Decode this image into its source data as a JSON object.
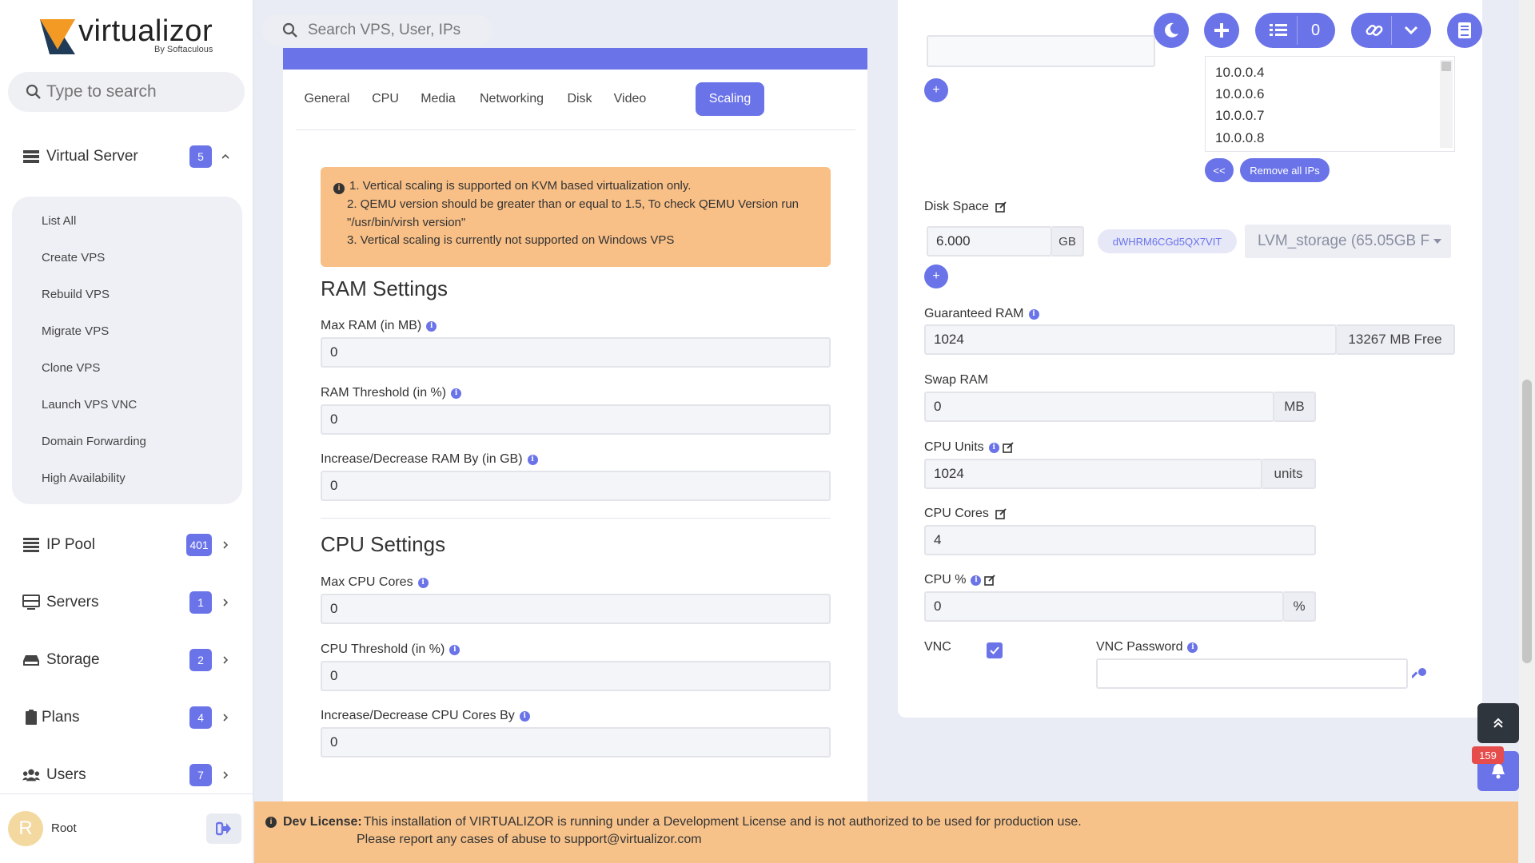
{
  "brand": {
    "name": "virtualizor",
    "by": "By Softaculous"
  },
  "sidebar": {
    "search_placeholder": "Type to search",
    "items": [
      {
        "label": "Virtual Server",
        "badge": "5"
      },
      {
        "label": "IP Pool",
        "badge": "401"
      },
      {
        "label": "Servers",
        "badge": "1"
      },
      {
        "label": "Storage",
        "badge": "2"
      },
      {
        "label": "Plans",
        "badge": "4"
      },
      {
        "label": "Users",
        "badge": "7"
      }
    ],
    "submenu": [
      "List All",
      "Create VPS",
      "Rebuild VPS",
      "Migrate VPS",
      "Clone VPS",
      "Launch VPS VNC",
      "Domain Forwarding",
      "High Availability"
    ],
    "user": {
      "initial": "R",
      "name": "Root"
    }
  },
  "topbar": {
    "search_placeholder": "Search VPS, User, IPs",
    "task_count": "0"
  },
  "tabs": [
    "General",
    "CPU",
    "Media",
    "Networking",
    "Disk",
    "Video",
    "Scaling"
  ],
  "alert": {
    "line1": "1. Vertical scaling is supported on KVM based virtualization only.",
    "line2": "2. QEMU version should be greater than or equal to 1.5, To check QEMU Version run \"/usr/bin/virsh version\"",
    "line3": "3. Vertical scaling is currently not supported on Windows VPS"
  },
  "ram_settings": {
    "title": "RAM Settings",
    "max_ram_label": "Max RAM (in MB)",
    "max_ram": "0",
    "threshold_label": "RAM Threshold (in %)",
    "threshold": "0",
    "increase_label": "Increase/Decrease RAM By (in GB)",
    "increase": "0"
  },
  "cpu_settings": {
    "title": "CPU Settings",
    "max_cores_label": "Max CPU Cores",
    "max_cores": "0",
    "threshold_label": "CPU Threshold (in %)",
    "threshold": "0",
    "increase_label": "Increase/Decrease CPU Cores By",
    "increase": "0"
  },
  "right": {
    "ips": [
      "10.0.0.4",
      "10.0.0.6",
      "10.0.0.7",
      "10.0.0.8"
    ],
    "ip_back": "<<",
    "remove_ips": "Remove all IPs",
    "disk_label": "Disk Space",
    "disk_value": "6.000",
    "disk_unit": "GB",
    "disk_id": "dWHRM6CGd5QX7VIT",
    "storage": "LVM_storage (65.05GB F",
    "guaranteed_ram_label": "Guaranteed RAM",
    "guaranteed_ram": "1024",
    "ram_free": "13267 MB Free",
    "swap_label": "Swap RAM",
    "swap": "0",
    "swap_unit": "MB",
    "cpu_units_label": "CPU Units",
    "cpu_units": "1024",
    "cpu_units_unit": "units",
    "cpu_cores_label": "CPU Cores",
    "cpu_cores": "4",
    "cpu_pct_label": "CPU %",
    "cpu_pct": "0",
    "cpu_pct_unit": "%",
    "vnc_label": "VNC",
    "vnc_password_label": "VNC Password"
  },
  "notif_count": "159",
  "license": {
    "title": "Dev License:",
    "line1": "This installation of VIRTUALIZOR is running under a Development License and is not authorized to be used for production use.",
    "line2": "Please report any cases of abuse to support@virtualizor.com"
  },
  "colors": {
    "accent": "#6a73e8",
    "warning": "#f8bf86",
    "danger": "#e74c4c"
  }
}
